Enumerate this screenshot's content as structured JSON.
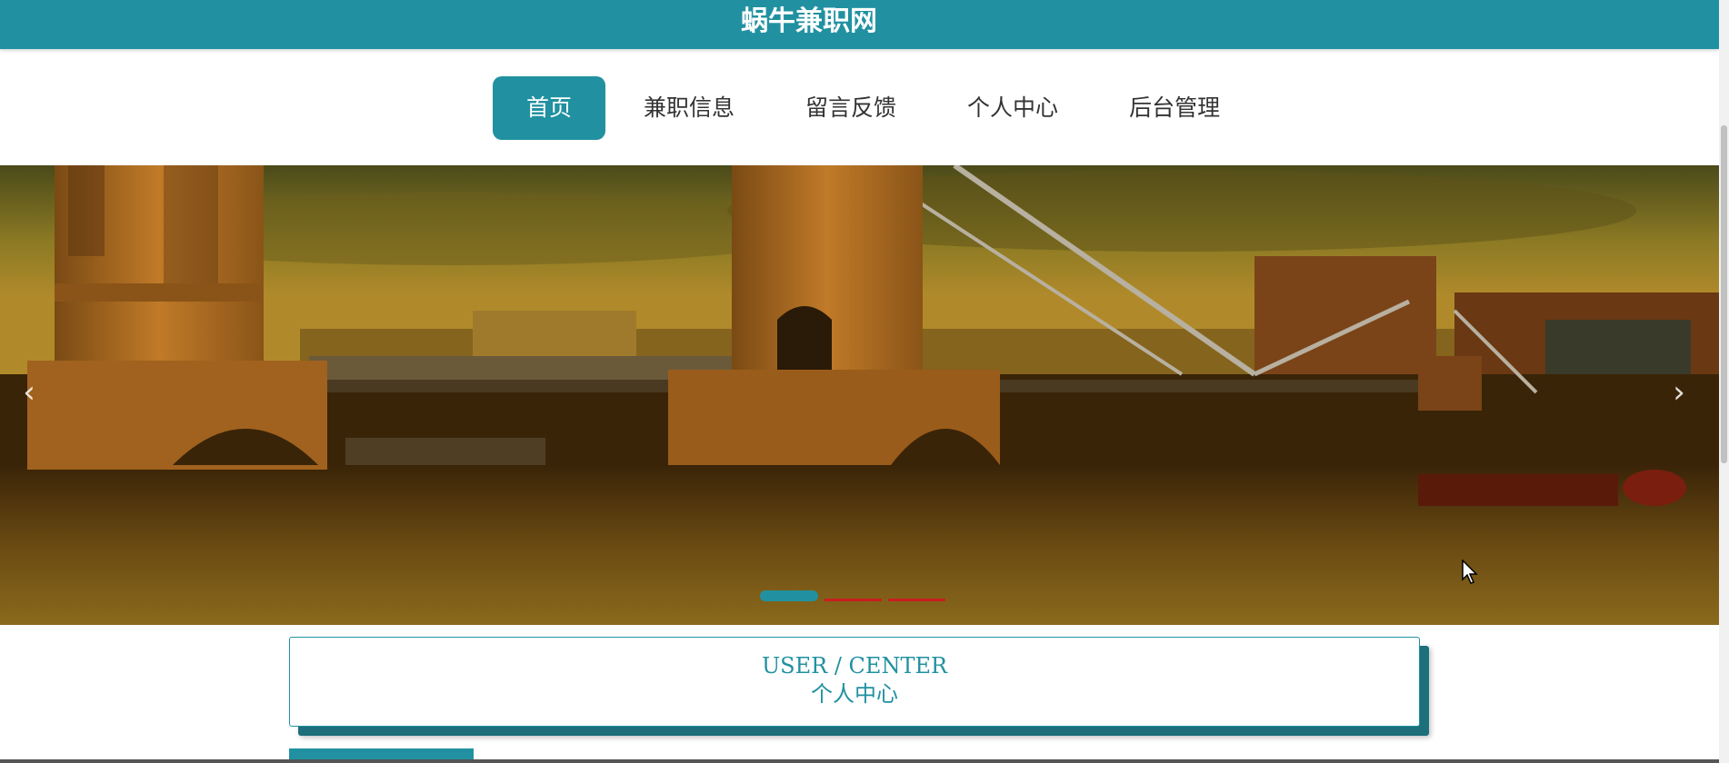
{
  "header": {
    "site_title": "蜗牛兼职网"
  },
  "nav": {
    "items": [
      {
        "label": "首页",
        "active": true
      },
      {
        "label": "兼职信息",
        "active": false
      },
      {
        "label": "留言反馈",
        "active": false
      },
      {
        "label": "个人中心",
        "active": false
      },
      {
        "label": "后台管理",
        "active": false
      }
    ]
  },
  "carousel": {
    "prev_icon": "chevron-left-icon",
    "next_icon": "chevron-right-icon",
    "prev_glyph": "‹",
    "next_glyph": "›",
    "slide_count": 3,
    "active_index": 0
  },
  "section": {
    "title_en": "USER / CENTER",
    "title_cn": "个人中心"
  },
  "colors": {
    "brand": "#2191a1",
    "dot_inactive": "#c81e1e",
    "shadow": "#1d6f7b"
  }
}
